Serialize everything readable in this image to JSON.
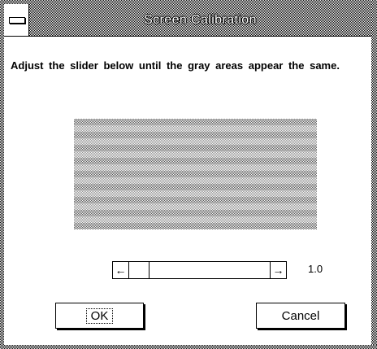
{
  "window": {
    "title": "Screen Calibration"
  },
  "dialog": {
    "instruction": "Adjust the slider below until the gray areas appear the same.",
    "slider": {
      "left_arrow": "←",
      "right_arrow": "→",
      "value_label": "1.0",
      "position_fraction": 0.0
    },
    "ok_label": "OK",
    "cancel_label": "Cancel"
  },
  "colors": {
    "frame": "#000000",
    "background": "#ffffff"
  },
  "icons": {
    "system_menu": "system-menu-icon"
  }
}
